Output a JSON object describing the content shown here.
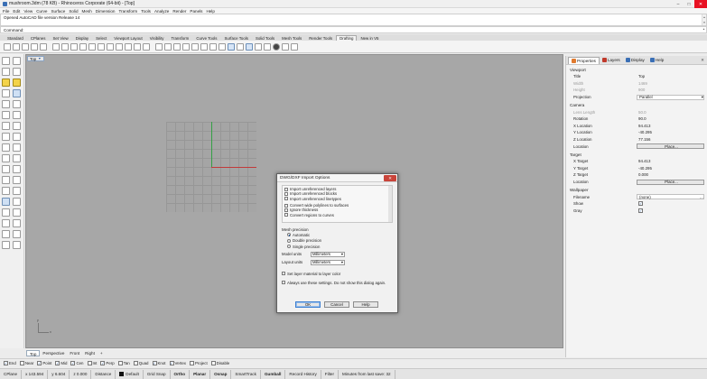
{
  "window": {
    "title": "mushroom.3dm (78 KB) - Rhinoceros Corporate (64-bit) - [Top]",
    "min": "–",
    "max": "□",
    "close": "✕"
  },
  "menu": [
    "File",
    "Edit",
    "View",
    "Curve",
    "Surface",
    "Solid",
    "Mesh",
    "Dimension",
    "Transform",
    "Tools",
    "Analyze",
    "Render",
    "Panels",
    "Help"
  ],
  "history": {
    "line1": "Opened AutoCAD file version Release 14"
  },
  "command": {
    "prompt": "Command:"
  },
  "toolbar_tabs": [
    {
      "label": "Standard",
      "active": false
    },
    {
      "label": "CPlanes",
      "active": false
    },
    {
      "label": "Set View",
      "active": false
    },
    {
      "label": "Display",
      "active": false
    },
    {
      "label": "Select",
      "active": false
    },
    {
      "label": "Viewport Layout",
      "active": false
    },
    {
      "label": "Visibility",
      "active": false
    },
    {
      "label": "Transform",
      "active": false
    },
    {
      "label": "Curve Tools",
      "active": false
    },
    {
      "label": "Surface Tools",
      "active": false
    },
    {
      "label": "Solid Tools",
      "active": false
    },
    {
      "label": "Mesh Tools",
      "active": false
    },
    {
      "label": "Render Tools",
      "active": false
    },
    {
      "label": "Drafting",
      "active": true
    },
    {
      "label": "New in V5",
      "active": false
    }
  ],
  "viewport": {
    "label": "Top",
    "caret": "▼",
    "axis_x": "x",
    "axis_y": "y"
  },
  "viewport_tabs": [
    {
      "label": "Top",
      "active": true
    },
    {
      "label": "Perspective",
      "active": false
    },
    {
      "label": "Front",
      "active": false
    },
    {
      "label": "Right",
      "active": false
    },
    {
      "label": "+",
      "active": false
    }
  ],
  "osnaps": [
    {
      "label": "End",
      "checked": true
    },
    {
      "label": "Near",
      "checked": false
    },
    {
      "label": "Point",
      "checked": true
    },
    {
      "label": "Mid",
      "checked": true
    },
    {
      "label": "Cen",
      "checked": true
    },
    {
      "label": "Int",
      "checked": false
    },
    {
      "label": "Perp",
      "checked": true
    },
    {
      "label": "Tan",
      "checked": false
    },
    {
      "label": "Quad",
      "checked": false
    },
    {
      "label": "Knot",
      "checked": true
    },
    {
      "label": "Vertex",
      "checked": true
    },
    {
      "label": "Project",
      "checked": false
    },
    {
      "label": "Disable",
      "checked": false
    }
  ],
  "status": {
    "cplane": "CPlane",
    "x": "x 143.594",
    "y": "y 6.604",
    "z": "z 0.000",
    "units": "Distance",
    "layer": "Default",
    "grid_snap": "Grid Snap",
    "ortho": "Ortho",
    "planar": "Planar",
    "osnap": "Osnap",
    "smarttrack": "SmartTrack",
    "gumball": "Gumball",
    "record_history": "Record History",
    "filter": "Filter",
    "save_msg": "Minutes from last save: 32"
  },
  "properties": {
    "tabs": [
      {
        "label": "Properties",
        "active": true,
        "color": "#e07a2e"
      },
      {
        "label": "Layers",
        "active": false,
        "color": "#c0392b"
      },
      {
        "label": "Display",
        "active": false,
        "color": "#3a6fb5"
      },
      {
        "label": "Help",
        "active": false,
        "color": "#3a6fb5"
      }
    ],
    "close": "✕",
    "sections": {
      "viewport": "Viewport",
      "camera": "Camera",
      "target": "Target",
      "wallpaper": "Wallpaper"
    },
    "viewport_rows": [
      {
        "key": "Title",
        "value": "Top",
        "dim": false,
        "type": "text"
      },
      {
        "key": "Width",
        "value": "1469",
        "dim": true,
        "type": "text"
      },
      {
        "key": "Height",
        "value": "900",
        "dim": true,
        "type": "text"
      },
      {
        "key": "Projection",
        "value": "Parallel",
        "dim": false,
        "type": "select"
      }
    ],
    "camera_rows": [
      {
        "key": "Lens Length",
        "value": "50.0",
        "dim": true,
        "type": "text"
      },
      {
        "key": "Rotation",
        "value": "90.0",
        "dim": false,
        "type": "text"
      },
      {
        "key": "X Location",
        "value": "94.413",
        "dim": false,
        "type": "text"
      },
      {
        "key": "Y Location",
        "value": "-40.295",
        "dim": false,
        "type": "text"
      },
      {
        "key": "Z Location",
        "value": "77.156",
        "dim": false,
        "type": "text"
      },
      {
        "key": "Location",
        "value": "Place...",
        "dim": false,
        "type": "button"
      }
    ],
    "target_rows": [
      {
        "key": "X Target",
        "value": "94.413",
        "dim": false,
        "type": "text"
      },
      {
        "key": "Y Target",
        "value": "-40.295",
        "dim": false,
        "type": "text"
      },
      {
        "key": "Z Target",
        "value": "0.000",
        "dim": false,
        "type": "text"
      },
      {
        "key": "Location",
        "value": "Place...",
        "dim": false,
        "type": "button"
      }
    ],
    "wallpaper_rows": [
      {
        "key": "Filename",
        "value": "(none)",
        "dim": false,
        "type": "file"
      },
      {
        "key": "Show",
        "value": "✓",
        "dim": false,
        "type": "check"
      },
      {
        "key": "Gray",
        "value": "✓",
        "dim": false,
        "type": "check"
      }
    ]
  },
  "dialog": {
    "title": "DWG/DXF Import Options",
    "close": "✕",
    "options": [
      "Import unreferenced layers",
      "Import unreferenced blocks",
      "Import unreferenced linetypes",
      "Convert wide polylines to surfaces",
      "Ignore thickness",
      "Convert regions to curves"
    ],
    "mesh_precision_label": "Mesh precision",
    "mesh_precision": [
      {
        "label": "Automatic",
        "selected": true
      },
      {
        "label": "Double precision",
        "selected": false
      },
      {
        "label": "Single precision",
        "selected": false
      }
    ],
    "model_units_label": "Model units",
    "model_units": "Millimeters",
    "layout_units_label": "Layout units",
    "layout_units": "Millimeters",
    "layer_material": "Set layer material to layer color",
    "always_use": "Always use these settings. Do not show this dialog again.",
    "ok": "OK",
    "cancel": "Cancel",
    "help": "Help",
    "caret": "▾"
  }
}
